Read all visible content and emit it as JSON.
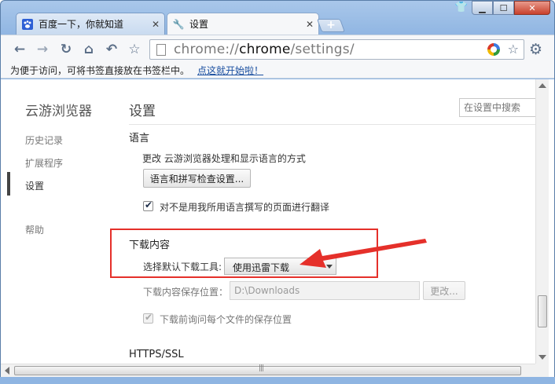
{
  "tabs": [
    {
      "label": "百度一下，你就知道",
      "icon": "baidu-paw-icon"
    },
    {
      "label": "设置",
      "icon": "wrench-icon"
    }
  ],
  "toolbar": {
    "url_prefix": "chrome://",
    "url_host": "chrome",
    "url_path": "/settings/"
  },
  "bookmarks": {
    "hint": "为便于访问，可将书签直接放在书签栏中。",
    "link": "点这就开始啦！"
  },
  "sidebar": {
    "title": "云游浏览器",
    "items": [
      {
        "label": "历史记录"
      },
      {
        "label": "扩展程序"
      },
      {
        "label": "设置"
      },
      {
        "label": "帮助"
      }
    ]
  },
  "main": {
    "title": "设置",
    "search_placeholder": "在设置中搜索",
    "language": {
      "title": "语言",
      "description": "更改 云游浏览器处理和显示语言的方式",
      "button": "语言和拼写检查设置...",
      "translate_label": "对不是用我所用语言撰写的页面进行翻译"
    },
    "download": {
      "title": "下载内容",
      "tool_label": "选择默认下载工具:",
      "tool_value": "使用迅雷下载",
      "location_label": "下载内容保存位置：",
      "location_value": "D:\\Downloads",
      "change_button": "更改...",
      "ask_label": "下载前询问每个文件的保存位置"
    },
    "https": {
      "title": "HTTPS/SSL"
    }
  },
  "colors": {
    "highlight_box": "#e5302a",
    "frame": "#8fb5e2"
  }
}
